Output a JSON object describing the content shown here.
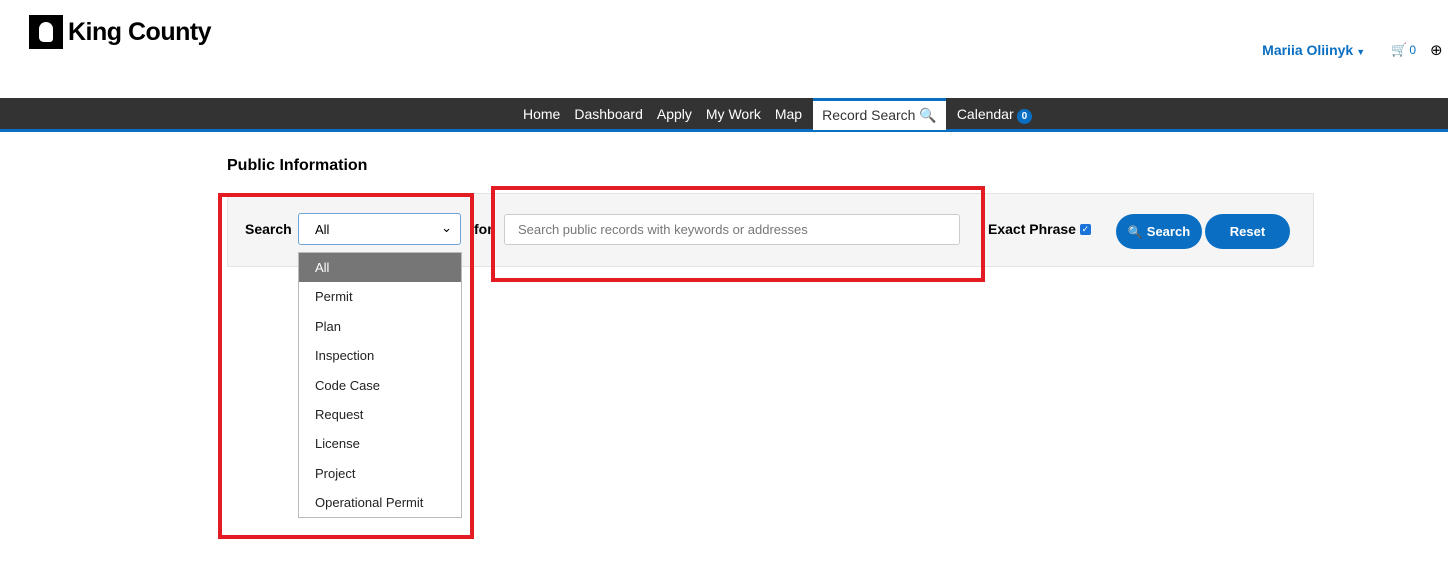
{
  "header": {
    "logo_text": "King County",
    "user_name": "Mariia Oliinyk",
    "cart_count": "0"
  },
  "nav": {
    "items": [
      {
        "label": "Home"
      },
      {
        "label": "Dashboard"
      },
      {
        "label": "Apply"
      },
      {
        "label": "My Work"
      },
      {
        "label": "Map"
      },
      {
        "label": "Record Search",
        "active": true
      },
      {
        "label": "Calendar",
        "badge": "0"
      }
    ]
  },
  "page": {
    "title": "Public Information"
  },
  "search": {
    "label": "Search",
    "selected": "All",
    "for_label": "for",
    "placeholder": "Search public records with keywords or addresses",
    "exact_phrase_label": "Exact Phrase",
    "exact_phrase_checked": true,
    "search_button": "Search",
    "reset_button": "Reset",
    "options": [
      "All",
      "Permit",
      "Plan",
      "Inspection",
      "Code Case",
      "Request",
      "License",
      "Project",
      "Operational Permit"
    ]
  },
  "colors": {
    "accent": "#0a6fc2",
    "nav_bg": "#333333",
    "highlight": "#e31c24",
    "selected_option_bg": "#767676"
  }
}
